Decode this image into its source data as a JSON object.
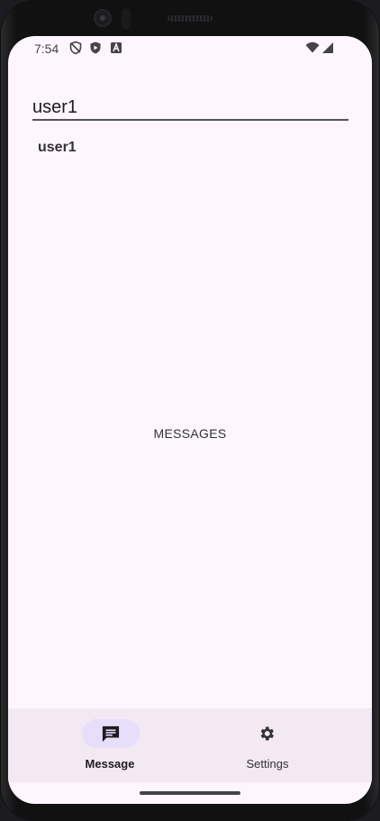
{
  "status_bar": {
    "time": "7:54",
    "left_icons": [
      "privacy-shield-icon",
      "play-protect-icon",
      "accessibility-a-icon"
    ],
    "right_icons": [
      "wifi-icon",
      "cell-signal-icon"
    ]
  },
  "search": {
    "value": "user1",
    "placeholder": ""
  },
  "user_list": [
    {
      "label": "user1"
    }
  ],
  "main": {
    "center_label": "MESSAGES"
  },
  "bottom_nav": {
    "items": [
      {
        "label": "Message",
        "icon": "message-icon",
        "active": true
      },
      {
        "label": "Settings",
        "icon": "gear-icon",
        "active": false
      }
    ]
  },
  "colors": {
    "screen_bg": "#fdf6fd",
    "nav_bg": "#f2e9f2",
    "active_pill": "#e7defa"
  }
}
